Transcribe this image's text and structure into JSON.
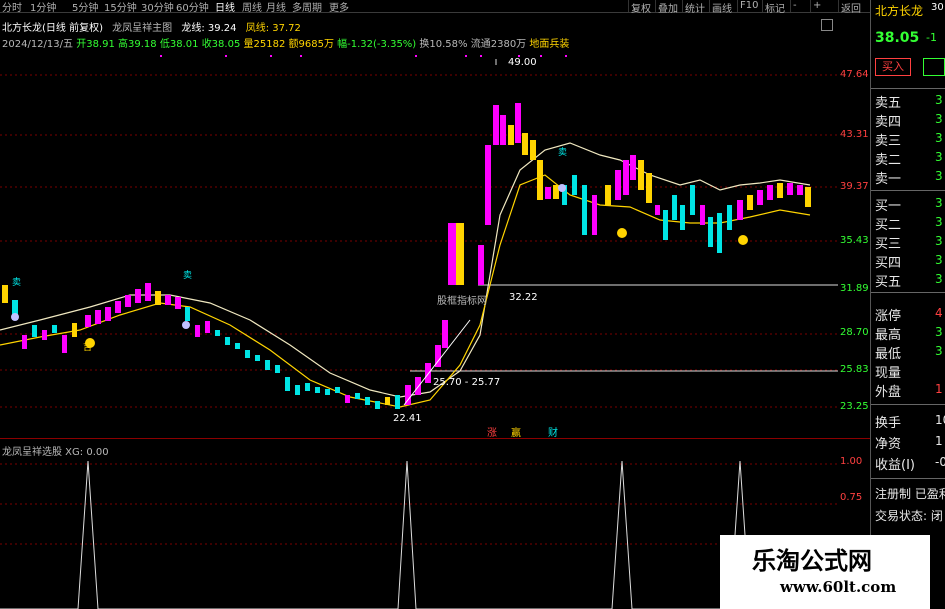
{
  "toolbar": {
    "tabs": [
      "分时",
      "1分钟",
      "5分钟",
      "15分钟",
      "30分钟",
      "60分钟",
      "日线",
      "周线",
      "月线",
      "多周期",
      "更多"
    ],
    "active": "日线",
    "right_buttons": [
      "复权",
      "叠加",
      "统计",
      "画线",
      "F10",
      "标记",
      "-",
      "+",
      "返回"
    ]
  },
  "chart_header": {
    "stock": "北方长龙(日线 前复权)",
    "indicator_name": "龙凤呈祥主图",
    "long_label": "龙线: 39.24",
    "feng_label": "凤线: 37.72"
  },
  "info_bar": {
    "date": "2024/12/13/五",
    "open": "开38.91",
    "high": "高39.18",
    "low": "低38.01",
    "close": "收38.05",
    "volume": "量25182",
    "amount": "额9685万",
    "change": "幅-1.32(-3.35%)",
    "turnover": "换10.58%",
    "float": "流通2380万",
    "tag": "地面兵装"
  },
  "y_axis": [
    "47.64",
    "43.31",
    "39.37",
    "35.43",
    "31.89",
    "28.70",
    "25.83",
    "23.25"
  ],
  "annotations": {
    "high": "49.00",
    "mid": "32.22",
    "low_range": "25.70 - 25.77",
    "low": "22.41",
    "box": "股框指标网",
    "markers": [
      "涨",
      "赢",
      "财"
    ],
    "sell": "卖",
    "buy": "吉"
  },
  "sub_chart": {
    "label": "龙凤呈祥选股  XG: 0.00",
    "ticks": [
      "1.00",
      "0.75"
    ]
  },
  "right_panel": {
    "title": "北方长龙",
    "code": "30",
    "price": "38.05",
    "change": "-1",
    "buy_label": "买入",
    "sell_rows": [
      "卖五",
      "卖四",
      "卖三",
      "卖二",
      "卖一"
    ],
    "buy_rows": [
      "买一",
      "买二",
      "买三",
      "买四",
      "买五"
    ],
    "book_values": [
      "3",
      "3",
      "3",
      "3",
      "3"
    ],
    "stats": [
      {
        "label": "涨停",
        "value": "4"
      },
      {
        "label": "最高",
        "value": "3"
      },
      {
        "label": "最低",
        "value": "3"
      },
      {
        "label": "现量",
        "value": ""
      },
      {
        "label": "外盘",
        "value": "1"
      }
    ],
    "stats2": [
      {
        "label": "换手",
        "value": "10."
      },
      {
        "label": "净资",
        "value": "1"
      },
      {
        "label": "收益(I)",
        "value": "-0."
      }
    ],
    "footer1": "注册制 已盈利",
    "footer2": "交易状态: 闭"
  },
  "watermark": {
    "title": "乐淘公式网",
    "url": "www.60lt.com"
  },
  "colors": {
    "up": "#ff00ff",
    "down": "#00e5e5",
    "yellow": "#ffd400",
    "long_line": "#f0e8c0",
    "grid": "#8b0000"
  }
}
